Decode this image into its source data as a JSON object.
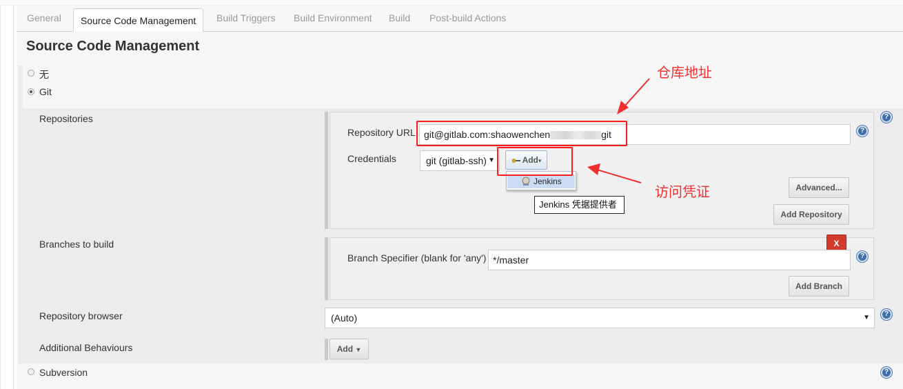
{
  "tabs": [
    {
      "label": "General",
      "active": false
    },
    {
      "label": "Source Code Management",
      "active": true
    },
    {
      "label": "Build Triggers",
      "active": false
    },
    {
      "label": "Build Environment",
      "active": false
    },
    {
      "label": "Build",
      "active": false
    },
    {
      "label": "Post-build Actions",
      "active": false
    }
  ],
  "section": {
    "title": "Source Code Management"
  },
  "scm_options": {
    "none": {
      "label": "无",
      "selected": false
    },
    "git": {
      "label": "Git",
      "selected": true
    },
    "subversion": {
      "label": "Subversion",
      "selected": false
    }
  },
  "repositories": {
    "label": "Repositories",
    "url_label": "Repository URL",
    "url_value_prefix": "git@gitlab.com:shaowenchen",
    "url_value_suffix": "git",
    "credentials_label": "Credentials",
    "credentials_selected": "git (gitlab-ssh)",
    "add_button": "Add",
    "dropdown_item": "Jenkins",
    "tooltip": "Jenkins 凭据提供者",
    "advanced_button": "Advanced...",
    "add_repository_button": "Add Repository"
  },
  "branches": {
    "label": "Branches to build",
    "delete_button": "X",
    "specifier_label": "Branch Specifier (blank for 'any')",
    "specifier_value": "*/master",
    "add_branch_button": "Add Branch"
  },
  "repository_browser": {
    "label": "Repository browser",
    "selected": "(Auto)"
  },
  "additional_behaviours": {
    "label": "Additional Behaviours",
    "add_button": "Add"
  },
  "annotations": {
    "repo_address": "仓库地址",
    "access_credential": "访问凭证"
  },
  "colors": {
    "annotation_red": "#f03030",
    "help_blue": "#3f6ea8",
    "delete_red": "#d23b2c"
  },
  "icons": [
    "help-icon",
    "key-icon",
    "jenkins-icon",
    "chevron-down-icon"
  ]
}
